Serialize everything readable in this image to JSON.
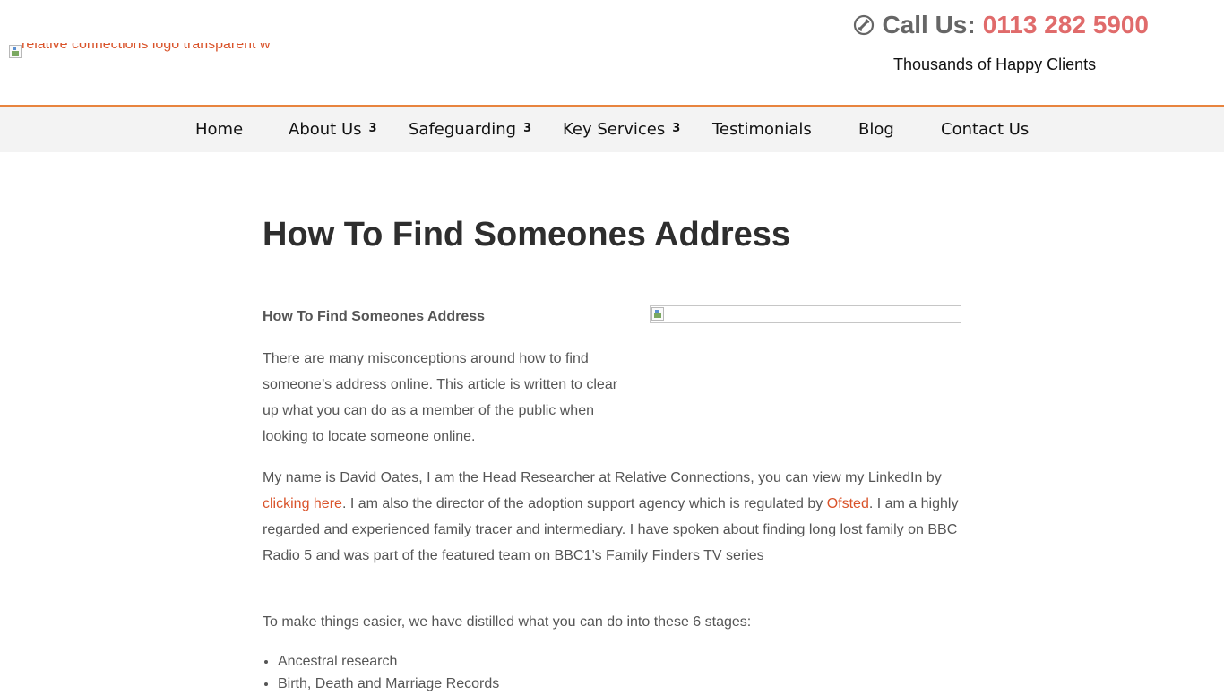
{
  "header": {
    "logo_alt": "relative connections logo transparent w",
    "call_label": "Call Us:",
    "phone": "0113 282 5900",
    "tagline": "Thousands of Happy Clients"
  },
  "nav": {
    "items": [
      {
        "label": "Home",
        "has_dropdown": false
      },
      {
        "label": "About Us",
        "has_dropdown": true
      },
      {
        "label": "Safeguarding",
        "has_dropdown": true
      },
      {
        "label": "Key Services",
        "has_dropdown": true
      },
      {
        "label": "Testimonials",
        "has_dropdown": false
      },
      {
        "label": "Blog",
        "has_dropdown": false
      },
      {
        "label": "Contact Us",
        "has_dropdown": false
      }
    ],
    "dropdown_glyph": "3",
    "accent_color": "#e8843e"
  },
  "article": {
    "title": "How To Find Someones Address",
    "subheading": "How To Find Someones Address",
    "p1": "There are many misconceptions around how to find someone’s address online. This article is written to clear up what you can do as a member of the public when looking to locate someone online.",
    "p2_a": "My name is David Oates, I am the Head Researcher at Relative Connections, you can view my LinkedIn by ",
    "p2_link1": "clicking here",
    "p2_b": ". I am also the director of the adoption support agency which is regulated by ",
    "p2_link2": "Ofsted",
    "p2_c": ". I am a highly regarded and experienced family tracer and intermediary. I have spoken about finding long lost family on BBC Radio 5 and was part of the featured team on BBC1’s Family Finders TV series",
    "p3": "To make things easier, we have distilled what you can do into these 6 stages:",
    "stages": [
      "Ancestral research",
      "Birth, Death and Marriage Records"
    ]
  },
  "colors": {
    "link": "#d9532a",
    "phone": "#e06b6b",
    "body_text": "#555555",
    "nav_bg": "#f3f3f3"
  }
}
